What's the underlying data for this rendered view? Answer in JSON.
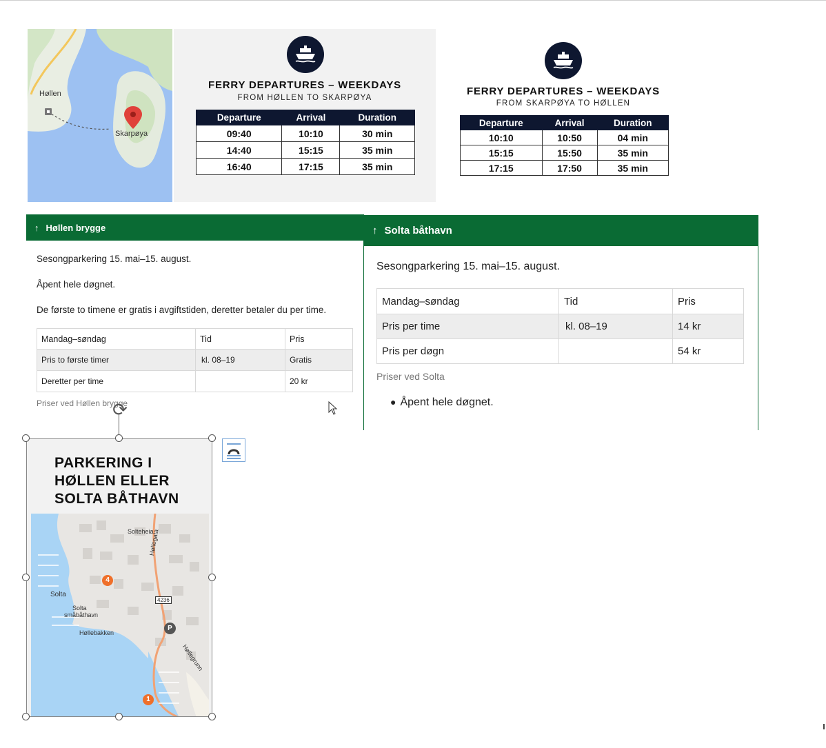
{
  "map_top": {
    "labels": {
      "hollen": "Høllen",
      "skarpoya": "Skarpøya"
    }
  },
  "ferry_left": {
    "title": "FERRY DEPARTURES – WEEKDAYS",
    "subtitle": "FROM HØLLEN TO SKARPØYA",
    "columns": [
      "Departure",
      "Arrival",
      "Duration"
    ],
    "rows": [
      [
        "09:40",
        "10:10",
        "30 min"
      ],
      [
        "14:40",
        "15:15",
        "35 min"
      ],
      [
        "16:40",
        "17:15",
        "35 min"
      ]
    ]
  },
  "ferry_right": {
    "title": "FERRY DEPARTURES – WEEKDAYS",
    "subtitle": "FROM SKARPØYA TO HØLLEN",
    "columns": [
      "Departure",
      "Arrival",
      "Duration"
    ],
    "rows": [
      [
        "10:10",
        "10:50",
        "04 min"
      ],
      [
        "15:15",
        "15:50",
        "35 min"
      ],
      [
        "17:15",
        "17:50",
        "35 min"
      ]
    ]
  },
  "parking_hollen": {
    "arrow": "↑",
    "heading": "Høllen brygge",
    "line1": "Sesongparkering 15. mai–15. august.",
    "line2": "Åpent hele døgnet.",
    "line3": "De første to timene er gratis i avgiftstiden, deretter betaler du per time.",
    "columns": [
      "Mandag–søndag",
      "Tid",
      "Pris"
    ],
    "rows": [
      [
        "Pris to første timer",
        "kl. 08–19",
        "Gratis"
      ],
      [
        "Deretter per time",
        "",
        "20 kr"
      ]
    ],
    "caption": "Priser ved Høllen brygge"
  },
  "parking_solta": {
    "arrow": "↑",
    "heading": "Solta båthavn",
    "line1": "Sesongparkering 15. mai–15. august.",
    "columns": [
      "Mandag–søndag",
      "Tid",
      "Pris"
    ],
    "rows": [
      [
        "Pris per time",
        "kl. 08–19",
        "14 kr"
      ],
      [
        "Pris per døgn",
        "",
        "54 kr"
      ]
    ],
    "caption": "Priser ved Solta",
    "bullet": "Åpent hele døgnet."
  },
  "poster": {
    "title_line1": "PARKERING I",
    "title_line2": "HØLLEN ELLER",
    "title_line3": "SOLTA BÅTHAVN",
    "map_labels": {
      "solteheia": "Solteheia",
      "hollegata": "Høllegata",
      "road_number": "4236",
      "solta": "Solta",
      "smabathavn_1": "Solta",
      "smabathavn_2": "småbåthavn",
      "hollebakken": "Høllebakken",
      "hollegrunn": "Høllegrunn",
      "marker_4": "4",
      "marker_1": "1",
      "marker_p": "P"
    }
  },
  "icons": {
    "ferry": "ferry-icon",
    "rotate": "rotate-handle-icon",
    "layout": "layout-options-icon",
    "cursor": "mouse-pointer-icon",
    "map_pin": "map-pin-icon"
  },
  "colors": {
    "navy": "#0e1730",
    "green": "#0a6b34",
    "water": "#9dc1f2",
    "pin": "#e0413a",
    "marker": "#ef6f2a"
  }
}
